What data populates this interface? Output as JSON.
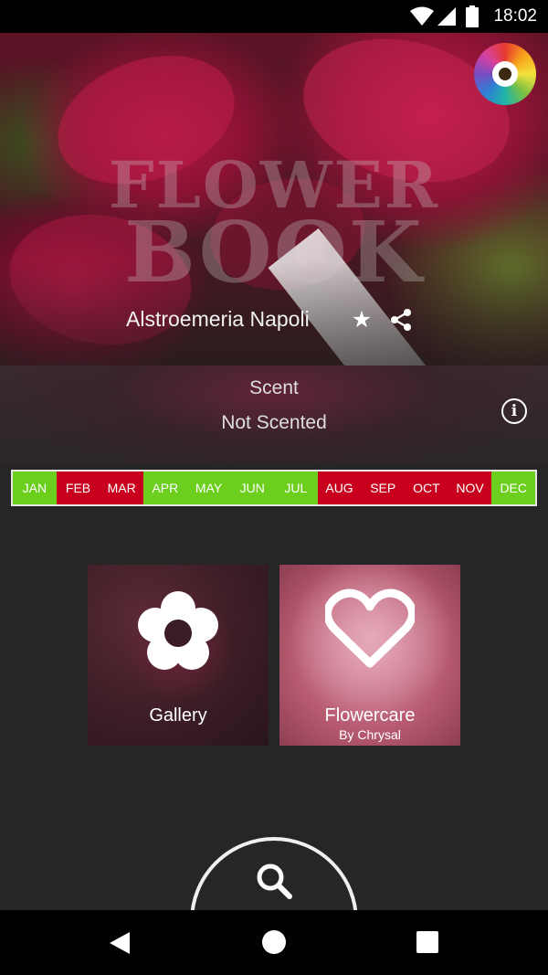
{
  "status_bar": {
    "time": "18:02",
    "icons": [
      "wifi-icon",
      "signal-icon",
      "battery-icon"
    ]
  },
  "hero": {
    "watermark_line1": "FLOWER",
    "watermark_line2": "BOOK",
    "flower_name": "Alstroemeria Napoli",
    "favorite_icon": "star-icon",
    "share_icon": "share-icon",
    "logo_icon": "flower-wheel-logo"
  },
  "scent": {
    "label": "Scent",
    "value": "Not Scented",
    "info_icon": "info-icon"
  },
  "availability": {
    "months": [
      {
        "label": "JAN",
        "status": "available"
      },
      {
        "label": "FEB",
        "status": "unavailable"
      },
      {
        "label": "MAR",
        "status": "unavailable"
      },
      {
        "label": "APR",
        "status": "available"
      },
      {
        "label": "MAY",
        "status": "available"
      },
      {
        "label": "JUN",
        "status": "available"
      },
      {
        "label": "JUL",
        "status": "available"
      },
      {
        "label": "AUG",
        "status": "unavailable"
      },
      {
        "label": "SEP",
        "status": "unavailable"
      },
      {
        "label": "OCT",
        "status": "unavailable"
      },
      {
        "label": "NOV",
        "status": "unavailable"
      },
      {
        "label": "DEC",
        "status": "available"
      }
    ],
    "colors": {
      "available": "#6ccf1e",
      "unavailable": "#c8001e"
    }
  },
  "tiles": {
    "gallery": {
      "label": "Gallery",
      "icon": "flower-icon"
    },
    "flowercare": {
      "label": "Flowercare",
      "sublabel": "By Chrysal",
      "icon": "heart-icon"
    }
  },
  "search": {
    "icon": "search-icon"
  },
  "nav_bar": {
    "icons": [
      "back-icon",
      "home-icon",
      "recents-icon"
    ]
  }
}
